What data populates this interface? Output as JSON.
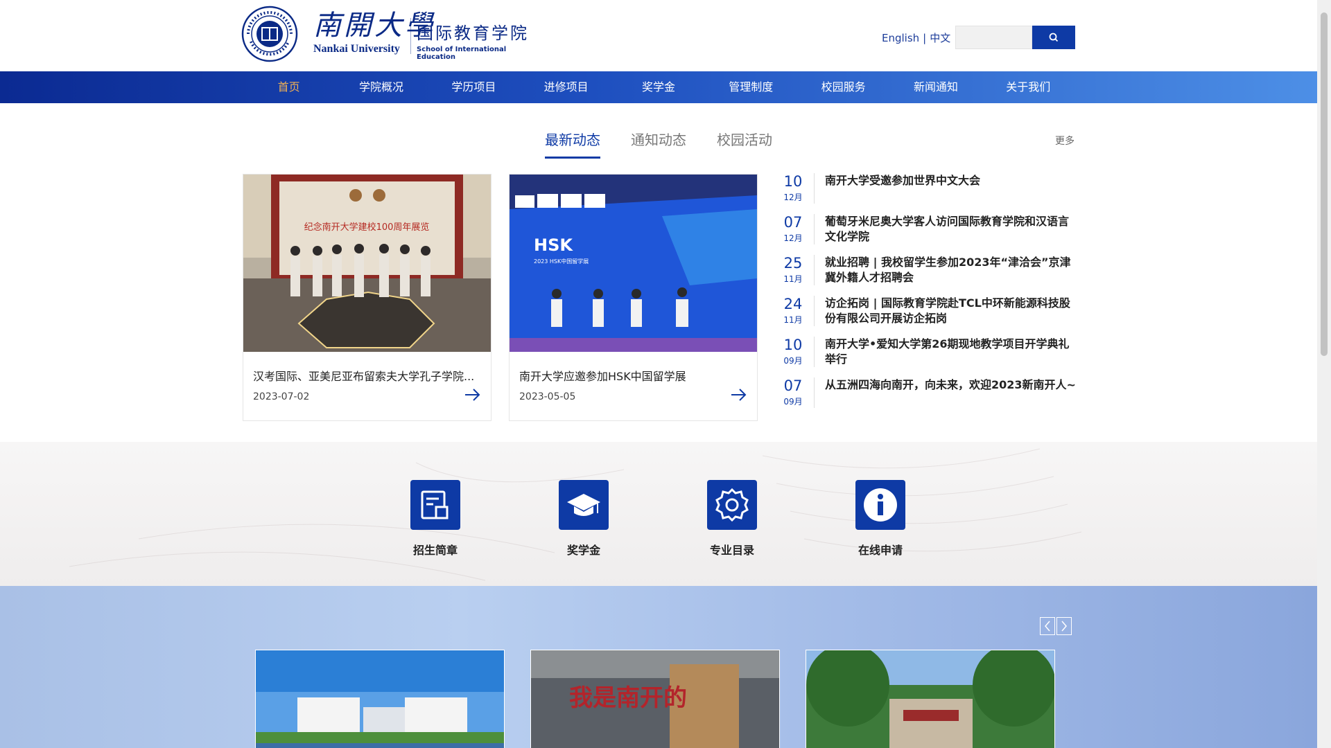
{
  "header": {
    "logo_cn": "南開大學",
    "logo_en": "Nankai University",
    "school_cn": "国际教育学院",
    "school_en": "School of International Education",
    "seal_text": "SCHOOL OF INTERNATIONAL EDUCATION · NKU 1919",
    "lang_en": "English",
    "lang_sep": "|",
    "lang_cn": "中文",
    "search_placeholder": ""
  },
  "nav": {
    "items": [
      {
        "label": "首页"
      },
      {
        "label": "学院概况"
      },
      {
        "label": "学历项目"
      },
      {
        "label": "进修项目"
      },
      {
        "label": "奖学金"
      },
      {
        "label": "管理制度"
      },
      {
        "label": "校园服务"
      },
      {
        "label": "新闻通知"
      },
      {
        "label": "关于我们"
      }
    ]
  },
  "news": {
    "tabs": [
      {
        "label": "最新动态"
      },
      {
        "label": "通知动态"
      },
      {
        "label": "校园活动"
      }
    ],
    "more": "更多",
    "cards": [
      {
        "title": "汉考国际、亚美尼亚布留索夫大学孔子学院...",
        "date": "2023-07-02",
        "photo_caption": "纪念南开大学建校100周年展览"
      },
      {
        "title": "南开大学应邀参加HSK中国留学展",
        "date": "2023-05-05",
        "photo_caption": "2023 HSK中国留学展"
      }
    ],
    "items": [
      {
        "day": "10",
        "month": "12月",
        "title": "南开大学受邀参加世界中文大会"
      },
      {
        "day": "07",
        "month": "12月",
        "title": "葡萄牙米尼奥大学客人访问国际教育学院和汉语言文化学院"
      },
      {
        "day": "25",
        "month": "11月",
        "title": "就业招聘 | 我校留学生参加2023年“津洽会”京津冀外籍人才招聘会"
      },
      {
        "day": "24",
        "month": "11月",
        "title": "访企拓岗 | 国际教育学院赴TCL中环新能源科技股份有限公司开展访企拓岗"
      },
      {
        "day": "10",
        "month": "09月",
        "title": "南开大学•爱知大学第26期现地教学项目开学典礼举行"
      },
      {
        "day": "07",
        "month": "09月",
        "title": "从五洲四海向南开，向未来，欢迎2023新南开人~"
      }
    ]
  },
  "quick_links": [
    {
      "label": "招生简章",
      "icon": "brochure-icon"
    },
    {
      "label": "奖学金",
      "icon": "graduation-cap-icon"
    },
    {
      "label": "专业目录",
      "icon": "gear-icon"
    },
    {
      "label": "在线申请",
      "icon": "info-icon"
    }
  ],
  "gallery": {
    "photo_caption_2": "我是南开的"
  },
  "colors": {
    "brand_blue": "#0e3aa5",
    "nav_active": "#f0b055"
  }
}
